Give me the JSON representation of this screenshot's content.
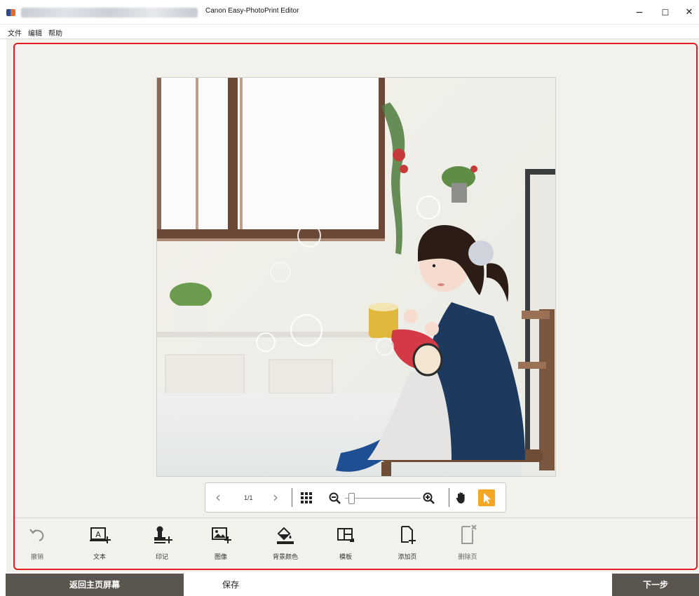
{
  "window": {
    "title": "Canon Easy-PhotoPrint Editor",
    "controls": {
      "minimize": "−",
      "maximize": "☐",
      "close": "✕"
    }
  },
  "menu": {
    "items": [
      "文件",
      "编辑",
      "帮助"
    ]
  },
  "page_nav": {
    "prev_icon": "chevron-left-icon",
    "page_indicator": "1/1",
    "next_icon": "chevron-right-icon",
    "grid_icon": "grid-icon",
    "zoom_out_icon": "zoom-out-icon",
    "zoom_in_icon": "zoom-in-icon",
    "hand_icon": "hand-icon",
    "pointer_icon": "pointer-icon",
    "zoom_level": 0.05,
    "accent_color": "#f5a623"
  },
  "toolbar": {
    "items": [
      {
        "label": "撤销",
        "icon": "undo-icon"
      },
      {
        "label": "文本",
        "icon": "text-box-icon"
      },
      {
        "label": "印记",
        "icon": "stamp-icon"
      },
      {
        "label": "图像",
        "icon": "image-icon"
      },
      {
        "label": "背景颜色",
        "icon": "paint-bucket-icon"
      },
      {
        "label": "模板",
        "icon": "template-icon"
      },
      {
        "label": "添加页",
        "icon": "add-page-icon"
      },
      {
        "label": "删除页",
        "icon": "delete-page-icon"
      }
    ]
  },
  "footer": {
    "home_button": "返回主页屏幕",
    "save_button": "保存",
    "next_button": "下一步"
  },
  "colors": {
    "highlight_border": "#e01e24",
    "workspace_bg": "#f3f1ec",
    "footer_dark": "#5b5550"
  }
}
